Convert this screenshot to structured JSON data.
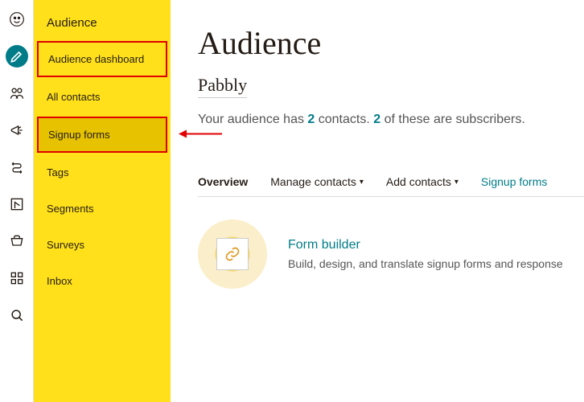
{
  "sidebar": {
    "title": "Audience",
    "items": [
      {
        "label": "Audience dashboard"
      },
      {
        "label": "All contacts"
      },
      {
        "label": "Signup forms"
      },
      {
        "label": "Tags"
      },
      {
        "label": "Segments"
      },
      {
        "label": "Surveys"
      },
      {
        "label": "Inbox"
      }
    ]
  },
  "page": {
    "heading": "Audience",
    "subtitle": "Pabbly",
    "stats_pre": "Your audience has ",
    "stats_count1": "2",
    "stats_mid1": " contacts. ",
    "stats_count2": "2",
    "stats_mid2": " of these are subscribers."
  },
  "menu": {
    "overview": "Overview",
    "manage": "Manage contacts",
    "add": "Add contacts",
    "signup": "Signup forms"
  },
  "card": {
    "title": "Form builder",
    "desc": "Build, design, and translate signup forms and response"
  }
}
